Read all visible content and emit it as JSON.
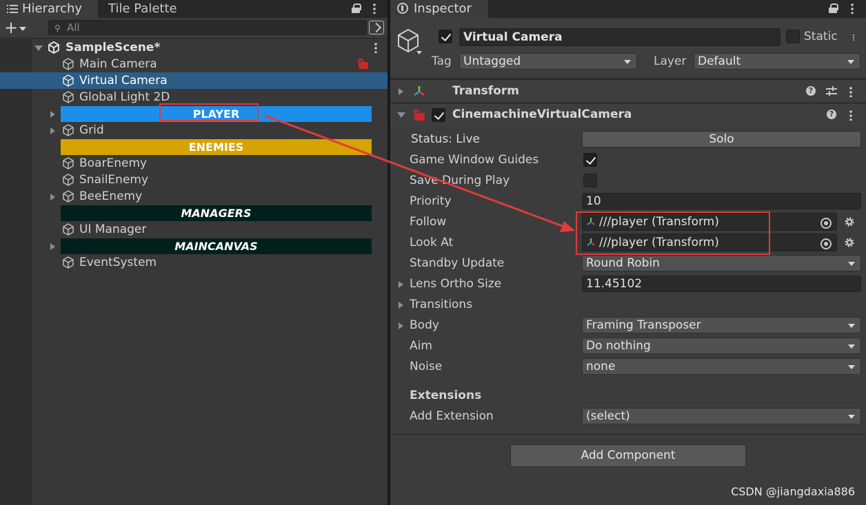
{
  "hierarchy": {
    "tabs": [
      "Hierarchy",
      "Tile Palette"
    ],
    "search_placeholder": "All",
    "scene_name": "SampleScene*",
    "items": [
      {
        "label": "Main Camera"
      },
      {
        "label": "Virtual Camera"
      },
      {
        "label": "Global Light 2D"
      },
      {
        "label": "PLAYER",
        "bar_color": "#1e8fe8"
      },
      {
        "label": "Grid"
      },
      {
        "label": "ENEMIES",
        "bar_color": "#d6a400"
      },
      {
        "label": "BoarEnemy"
      },
      {
        "label": "SnailEnemy"
      },
      {
        "label": "BeeEnemy"
      },
      {
        "label": "MANAGERS",
        "bar_color": "#00201e"
      },
      {
        "label": "UI Manager"
      },
      {
        "label": "MAINCANVAS",
        "bar_color": "#00201e"
      },
      {
        "label": "EventSystem"
      }
    ]
  },
  "inspector": {
    "tab": "Inspector",
    "object_name": "Virtual Camera",
    "static_label": "Static",
    "tag_label": "Tag",
    "tag_value": "Untagged",
    "layer_label": "Layer",
    "layer_value": "Default",
    "transform_title": "Transform",
    "vcam_title": "CinemachineVirtualCamera",
    "status_label": "Status: Live",
    "solo_button": "Solo",
    "game_window_guides_label": "Game Window Guides",
    "save_during_play_label": "Save During Play",
    "priority_label": "Priority",
    "priority_value": "10",
    "follow_label": "Follow",
    "follow_value": "///player (Transform)",
    "look_at_label": "Look At",
    "look_at_value": "///player (Transform)",
    "standby_label": "Standby Update",
    "standby_value": "Round Robin",
    "lens_label": "Lens Ortho Size",
    "lens_value": "11.45102",
    "transitions_label": "Transitions",
    "body_label": "Body",
    "body_value": "Framing Transposer",
    "aim_label": "Aim",
    "aim_value": "Do nothing",
    "noise_label": "Noise",
    "noise_value": "none",
    "extensions_label": "Extensions",
    "add_extension_label": "Add Extension",
    "add_extension_value": "(select)",
    "add_component_button": "Add Component"
  },
  "watermark": "CSDN @jiangdaxia886",
  "colors": {
    "selection": "#2c5d87",
    "annotation_red": "#e23b3b"
  }
}
